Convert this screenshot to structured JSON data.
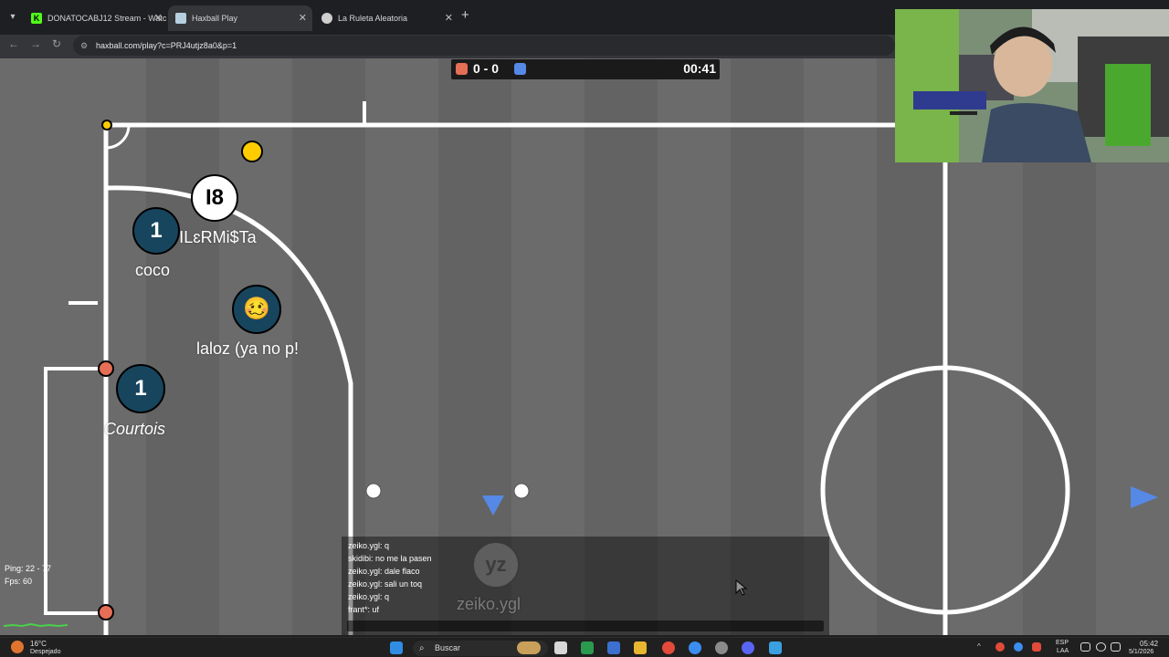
{
  "browser": {
    "tabs": [
      {
        "title": "DONATOCABJ12 Stream - Watc",
        "favicon": "kick-icon",
        "color": "#53fc18"
      },
      {
        "title": "Haxball Play",
        "favicon": "haxball-icon",
        "color": "#b8cfe0"
      },
      {
        "title": "La Ruleta Aleatoria",
        "favicon": "wheel-icon",
        "color": "#cfcfcf"
      }
    ],
    "url": "haxball.com/play?c=PRJ4utjz8a0&p=1"
  },
  "scoreboard": {
    "score": "0 - 0",
    "time": "00:41",
    "red_color": "#e56e56",
    "blue_color": "#5689e5"
  },
  "players": [
    {
      "avatar": "1",
      "name": "coco",
      "team": "dark"
    },
    {
      "avatar": "I8",
      "name": "ꓲLɛRMi$Ta",
      "team": "white"
    },
    {
      "avatar": "🥴",
      "name": "laloz (ya no p!",
      "team": "dark"
    },
    {
      "avatar": "1",
      "name": "Courtois",
      "team": "dark"
    },
    {
      "avatar": "yz",
      "name": "zeiko.ygl",
      "team": "self"
    }
  ],
  "chat": {
    "messages": [
      "zeiko.ygl: q",
      "skidibi: no me la pasen",
      "zeiko.ygl: dale flaco",
      "zeiko.ygl: sali un toq",
      "zeiko.ygl: q",
      "frant*: uf"
    ]
  },
  "stats": {
    "ping": "Ping: 22 - 77",
    "fps": "Fps: 60"
  },
  "taskbar": {
    "weather_temp": "16°C",
    "weather_desc": "Despejado",
    "search": "Buscar",
    "lang": "ESP",
    "lang_sub": "LAA",
    "time": "05:42",
    "date": "5/1/2026"
  },
  "field_colors": {
    "grass": "#6b6b6b",
    "lines": "#ffffff",
    "post": "#e56e56",
    "corner": "#ffcc00"
  }
}
